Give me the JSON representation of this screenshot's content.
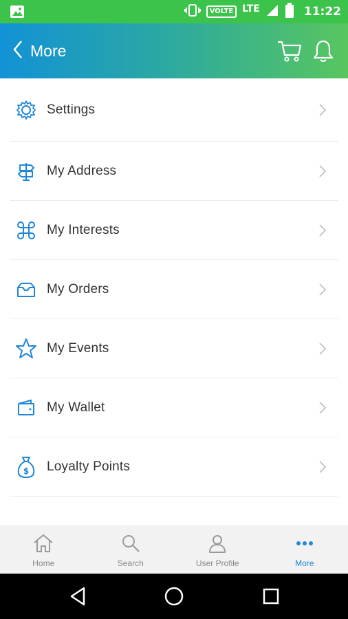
{
  "status_bar": {
    "volte": "VOLTE",
    "network": "LTE",
    "time": "11:22"
  },
  "app_bar": {
    "title": "More",
    "icons": [
      "back-chevron-icon",
      "cart-icon",
      "bell-icon"
    ]
  },
  "menu": {
    "items": [
      {
        "label": "Settings",
        "icon": "gear-icon"
      },
      {
        "label": "My Address",
        "icon": "signpost-icon"
      },
      {
        "label": "My Interests",
        "icon": "command-icon"
      },
      {
        "label": "My Orders",
        "icon": "envelope-tray-icon"
      },
      {
        "label": "My Events",
        "icon": "star-icon"
      },
      {
        "label": "My Wallet",
        "icon": "wallet-icon"
      },
      {
        "label": "Loyalty Points",
        "icon": "money-bag-icon"
      }
    ]
  },
  "tab_bar": {
    "active": "More",
    "tabs": [
      {
        "label": "Home",
        "icon": "home-icon"
      },
      {
        "label": "Search",
        "icon": "search-icon"
      },
      {
        "label": "User Profile",
        "icon": "user-icon"
      },
      {
        "label": "More",
        "icon": "more-dots-icon"
      }
    ]
  },
  "colors": {
    "status_bar": "#3cc34b",
    "app_bar_gradient_start": "#1292d6",
    "app_bar_gradient_end": "#58c65e",
    "menu_icon": "#1f86d8",
    "active_tab": "#1f86d8"
  }
}
